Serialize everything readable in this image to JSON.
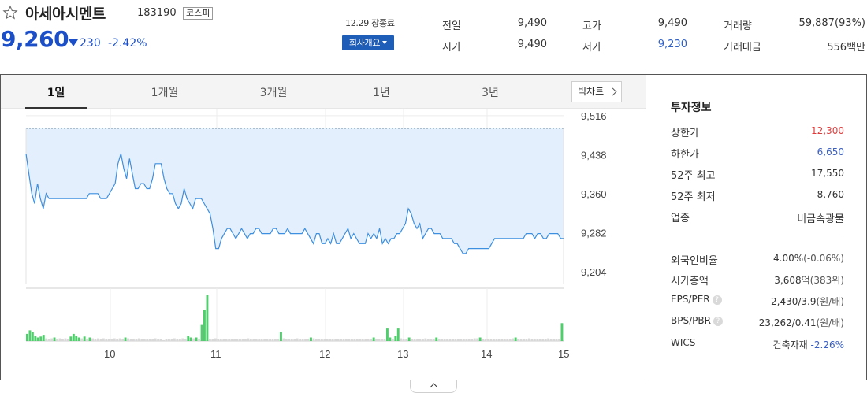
{
  "stock": {
    "name": "아세아시멘트",
    "code": "183190",
    "market": "코스피",
    "price": "9,260",
    "change_abs": "230",
    "change_pct": "-2.42%",
    "close_label": "12.29 장종료",
    "company_button": "회사개요"
  },
  "quotes": {
    "prev_close": {
      "label": "전일",
      "value": "9,490"
    },
    "open": {
      "label": "시가",
      "value": "9,490"
    },
    "high": {
      "label": "고가",
      "value": "9,490"
    },
    "low": {
      "label": "저가",
      "value": "9,230"
    },
    "volume": {
      "label": "거래량",
      "value": "59,887(93%)"
    },
    "amount": {
      "label": "거래대금",
      "value": "556백만"
    }
  },
  "tabs": [
    "1일",
    "1개월",
    "3개월",
    "1년",
    "3년"
  ],
  "active_tab": "1일",
  "bigchart_label": "빅차트",
  "invest": {
    "title": "투자정보",
    "upper_limit": {
      "label": "상한가",
      "value": "12,300"
    },
    "lower_limit": {
      "label": "하한가",
      "value": "6,650"
    },
    "high_52w": {
      "label": "52주 최고",
      "value": "17,550"
    },
    "low_52w": {
      "label": "52주 최저",
      "value": "8,760"
    },
    "industry": {
      "label": "업종",
      "value": "비금속광물"
    },
    "foreign_ratio": {
      "label": "외국인비율",
      "value": "4.00%",
      "sub": "(-0.06%)"
    },
    "market_cap": {
      "label": "시가총액",
      "value": "3,608",
      "sub": "억(383위)"
    },
    "eps_per": {
      "label": "EPS/PER",
      "value": "2,430/3.9",
      "sub": "(원/배)"
    },
    "bps_pbr": {
      "label": "BPS/PBR",
      "value": "23,262/0.41",
      "sub": "(원/배)"
    },
    "wics": {
      "label": "WICS",
      "value": "건축자재",
      "sub": "-2.26%"
    }
  },
  "colors": {
    "down_blue": "#1b4fc9",
    "line": "#3d8fe0",
    "area_fill": "#e3effc",
    "volume_bar": "#4fcf6c",
    "volume_bar_light": "#d8d8d8",
    "upper_red": "#e03b3b"
  },
  "chart_data": {
    "type": "line",
    "ylim": [
      9180,
      9530
    ],
    "y_ticks": [
      "9,516",
      "9,438",
      "9,360",
      "9,282",
      "9,204"
    ],
    "reference_line": 9490,
    "x_ticks": [
      "10",
      "11",
      "12",
      "13",
      "14",
      "15"
    ],
    "series": [
      {
        "values": [
          9440,
          9400,
          9360,
          9340,
          9380,
          9350,
          9330,
          9360,
          9350,
          9350,
          9350,
          9350,
          9350,
          9350,
          9350,
          9350,
          9350,
          9350,
          9350,
          9350,
          9350,
          9350,
          9360,
          9360,
          9360,
          9360,
          9350,
          9350,
          9350,
          9360,
          9370,
          9380,
          9420,
          9440,
          9410,
          9390,
          9430,
          9400,
          9370,
          9370,
          9380,
          9380,
          9370,
          9370,
          9390,
          9420,
          9420,
          9420,
          9390,
          9370,
          9360,
          9360,
          9340,
          9330,
          9340,
          9370,
          9350,
          9340,
          9330,
          9350,
          9350,
          9350,
          9340,
          9330,
          9320,
          9290,
          9250,
          9250,
          9270,
          9280,
          9290,
          9290,
          9280,
          9270,
          9280,
          9290,
          9280,
          9270,
          9280,
          9280,
          9290,
          9290,
          9280,
          9280,
          9280,
          9280,
          9290,
          9290,
          9280,
          9280,
          9280,
          9290,
          9280,
          9280,
          9280,
          9280,
          9280,
          9290,
          9280,
          9270,
          9260,
          9280,
          9280,
          9260,
          9260,
          9270,
          9260,
          9280,
          9260,
          9260,
          9270,
          9280,
          9290,
          9270,
          9280,
          9270,
          9260,
          9260,
          9260,
          9280,
          9270,
          9280,
          9270,
          9290,
          9260,
          9270,
          9260,
          9270,
          9270,
          9280,
          9280,
          9290,
          9300,
          9330,
          9320,
          9300,
          9290,
          9300,
          9270,
          9280,
          9290,
          9290,
          9280,
          9280,
          9280,
          9270,
          9270,
          9270,
          9270,
          9260,
          9260,
          9250,
          9240,
          9240,
          9250,
          9250,
          9250,
          9250,
          9250,
          9250,
          9250,
          9250,
          9260,
          9270,
          9270,
          9270,
          9270,
          9270,
          9270,
          9270,
          9270,
          9270,
          9270,
          9270,
          9280,
          9280,
          9280,
          9270,
          9280,
          9280,
          9270,
          9270,
          9280,
          9280,
          9280,
          9280,
          9270,
          9270
        ]
      },
      {
        "name": "volume",
        "values": [
          8,
          12,
          10,
          6,
          4,
          5,
          7,
          3,
          2,
          3,
          4,
          2,
          3,
          2,
          3,
          2,
          5,
          8,
          6,
          4,
          3,
          5,
          2,
          4,
          3,
          2,
          3,
          2,
          3,
          2,
          2,
          2,
          3,
          2,
          3,
          2,
          4,
          3,
          2,
          2,
          2,
          3,
          2,
          2,
          2,
          2,
          2,
          3,
          2,
          2,
          1,
          2,
          2,
          2,
          3,
          2,
          2,
          3,
          2,
          6,
          4,
          3,
          4,
          2,
          18,
          35,
          52,
          2,
          2,
          3,
          2,
          2,
          2,
          2,
          2,
          2,
          2,
          2,
          2,
          2,
          2,
          3,
          2,
          2,
          2,
          2,
          2,
          2,
          2,
          2,
          2,
          2,
          2,
          10,
          3,
          2,
          2,
          2,
          2,
          3,
          2,
          2,
          2,
          2,
          4,
          3,
          2,
          2,
          2,
          2,
          2,
          2,
          2,
          2,
          2,
          2,
          2,
          2,
          2,
          2,
          2,
          2,
          2,
          2,
          2,
          2,
          2,
          4,
          2,
          2,
          2,
          2,
          14,
          4,
          2,
          6,
          14,
          3,
          2,
          2,
          4,
          2,
          2,
          2,
          2,
          2,
          3,
          2,
          2,
          2,
          4,
          2,
          2,
          2,
          2,
          2,
          2,
          2,
          2,
          2,
          2,
          2,
          2,
          2,
          3,
          3,
          4,
          2,
          2,
          2,
          2,
          2,
          2,
          2,
          2,
          2,
          2,
          2,
          3,
          4,
          2,
          2,
          2,
          2,
          3,
          2,
          2,
          2,
          2,
          2,
          2,
          3,
          2,
          2,
          2,
          2,
          20
        ]
      }
    ]
  }
}
